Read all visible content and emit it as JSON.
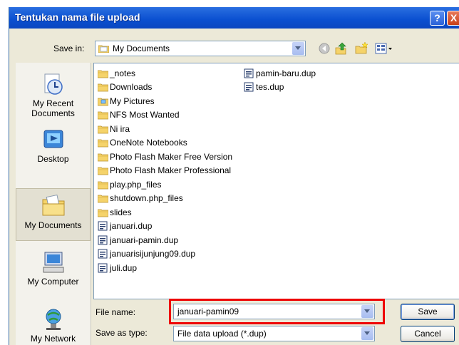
{
  "window": {
    "title": "Tentukan nama file upload"
  },
  "save_in": {
    "label": "Save in:",
    "value": "My Documents"
  },
  "toolbar": {
    "icons": [
      "back-icon",
      "up-folder-icon",
      "new-folder-icon",
      "views-menu-icon"
    ]
  },
  "places": [
    {
      "label": "My Recent Documents",
      "icon": "recent-documents-icon"
    },
    {
      "label": "Desktop",
      "icon": "desktop-icon"
    },
    {
      "label": "My Documents",
      "icon": "my-documents-icon",
      "selected": true
    },
    {
      "label": "My Computer",
      "icon": "my-computer-icon"
    },
    {
      "label": "My Network",
      "icon": "my-network-icon"
    }
  ],
  "files": {
    "column1": [
      {
        "name": "_notes",
        "type": "folder"
      },
      {
        "name": "Downloads",
        "type": "folder"
      },
      {
        "name": "My Pictures",
        "type": "folder-pictures"
      },
      {
        "name": "NFS Most Wanted",
        "type": "folder"
      },
      {
        "name": "Ni ira",
        "type": "folder"
      },
      {
        "name": "OneNote Notebooks",
        "type": "folder"
      },
      {
        "name": "Photo Flash Maker Free Version",
        "type": "folder"
      },
      {
        "name": "Photo Flash Maker Professional",
        "type": "folder"
      },
      {
        "name": "play.php_files",
        "type": "folder"
      },
      {
        "name": "shutdown.php_files",
        "type": "folder"
      },
      {
        "name": "slides",
        "type": "folder"
      },
      {
        "name": "januari.dup",
        "type": "file"
      },
      {
        "name": "januari-pamin.dup",
        "type": "file"
      },
      {
        "name": "januarisijunjung09.dup",
        "type": "file"
      },
      {
        "name": "juli.dup",
        "type": "file"
      }
    ],
    "column2": [
      {
        "name": "pamin-baru.dup",
        "type": "file"
      },
      {
        "name": "tes.dup",
        "type": "file"
      }
    ]
  },
  "file_name": {
    "label": "File name:",
    "value": "januari-pamin09"
  },
  "save_as_type": {
    "label": "Save as type:",
    "value": "File data upload (*.dup)"
  },
  "buttons": {
    "save": "Save",
    "cancel": "Cancel",
    "help": "?",
    "close": "X"
  },
  "colors": {
    "titlebar": "#0a4fd0",
    "highlight": "#e00000",
    "dialog_bg": "#ece9d8"
  }
}
